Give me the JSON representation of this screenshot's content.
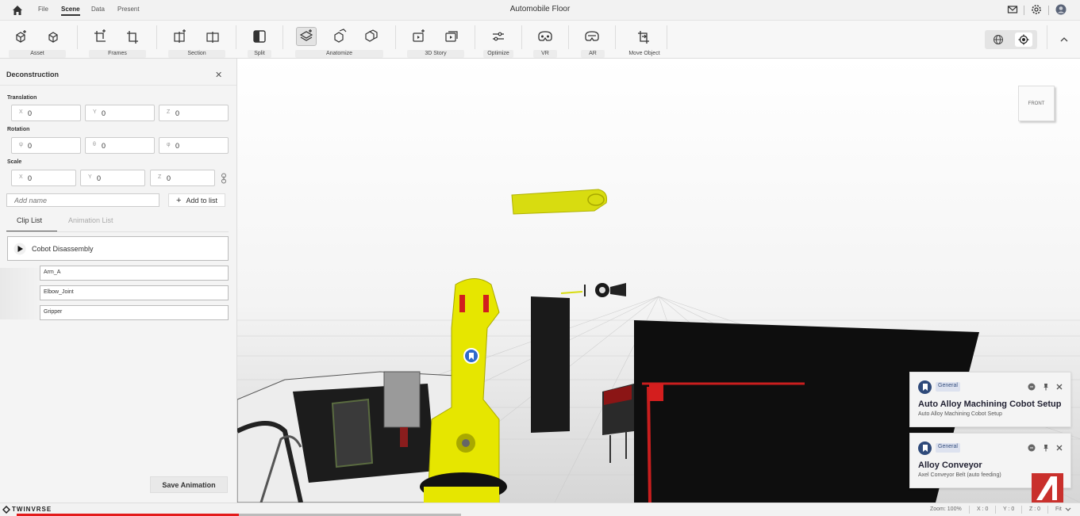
{
  "app": {
    "title": "Automobile Floor"
  },
  "menu": {
    "items": [
      "File",
      "Scene",
      "Data",
      "Present"
    ],
    "active": "Scene"
  },
  "top_right_icons": [
    "mail-icon",
    "gear-icon",
    "avatar"
  ],
  "toolbar": {
    "groups": [
      {
        "label": "Asset",
        "icons": [
          "add-asset-icon",
          "asset-icon"
        ]
      },
      {
        "label": "Frames",
        "icons": [
          "add-frame-icon",
          "frame-icon"
        ]
      },
      {
        "label": "Section",
        "icons": [
          "add-section-icon",
          "section-icon"
        ]
      },
      {
        "label": "Split",
        "icons": [
          "split-icon"
        ]
      },
      {
        "label": "Anatomize",
        "icons": [
          "anatomize-add-icon",
          "anatomize-icon",
          "anatomize-layers-icon"
        ]
      },
      {
        "label": "3D Story",
        "icons": [
          "add-story-icon",
          "story-icon"
        ]
      },
      {
        "label": "Optimize",
        "icons": [
          "sliders-icon"
        ]
      },
      {
        "label": "VR",
        "icons": [
          "vr-headset-icon"
        ]
      },
      {
        "label": "AR",
        "icons": [
          "ar-headset-icon"
        ]
      },
      {
        "label": "Move Object",
        "icons": [
          "move-object-icon"
        ]
      }
    ],
    "active_tool": "anatomize-add-icon"
  },
  "panel": {
    "title": "Deconstruction",
    "translation": {
      "label": "Translation",
      "x_axis": "X",
      "x": "0",
      "y_axis": "Y",
      "y": "0",
      "z_axis": "Z",
      "z": "0"
    },
    "rotation": {
      "label": "Rotation",
      "x_axis": "ψ",
      "x": "0",
      "y_axis": "θ",
      "y": "0",
      "z_axis": "φ",
      "z": "0"
    },
    "scale": {
      "label": "Scale",
      "x_axis": "X",
      "x": "0",
      "y_axis": "Y",
      "y": "0",
      "z_axis": "Z",
      "z": "0"
    },
    "name_placeholder": "Add name",
    "add_button": "Add to list",
    "tabs": [
      "Clip List",
      "Animation List"
    ],
    "active_tab": "Clip List",
    "clip": {
      "name": "Cobot Disassembly",
      "items": [
        "Arm_A",
        "Elbow_Joint",
        "Gripper"
      ]
    },
    "save_button": "Save Animation"
  },
  "viewport": {
    "view_cube_label": "FRONT"
  },
  "notifications": [
    {
      "tag": "General",
      "title": "Auto Alloy Machining Cobot Setup",
      "subtitle": "Auto Alloy Machining Cobot Setup"
    },
    {
      "tag": "General",
      "title": "Alloy Conveyor",
      "subtitle": "Axel Conveyor Belt (auto feeding)"
    }
  ],
  "statusbar": {
    "brand": "TWINVRSE",
    "zoom": "Zoom: 100%",
    "x": "X : 0",
    "y": "Y : 0",
    "z": "Z : 0",
    "fit": "Fit"
  },
  "progress": 0.5,
  "colors": {
    "accent": "#2f4a7a",
    "robot": "#e6e600",
    "progress": "#e31b1b",
    "brand": "#c9302c"
  }
}
